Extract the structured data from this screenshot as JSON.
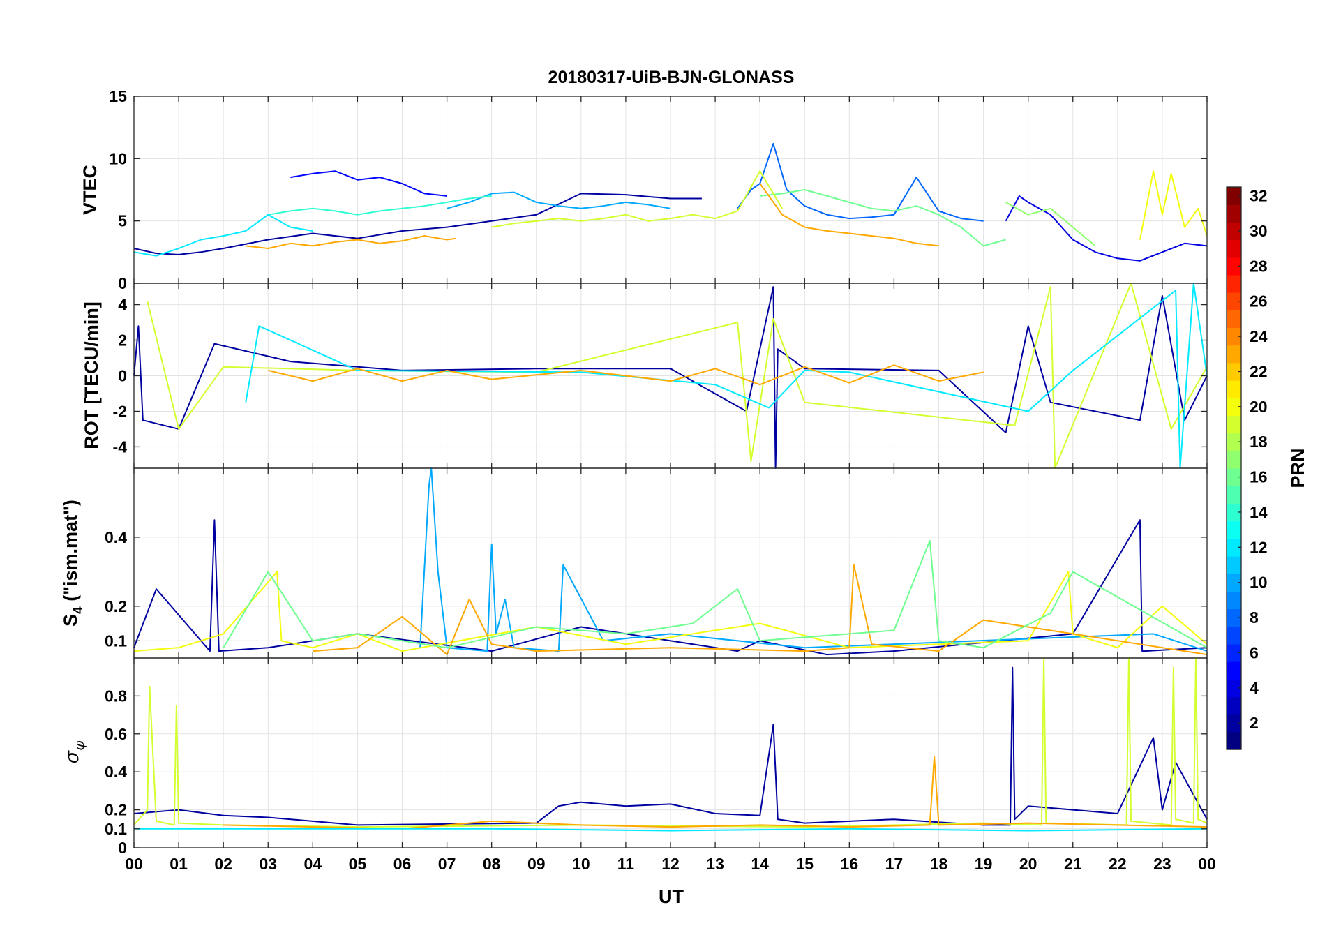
{
  "chart_data": [
    {
      "type": "line",
      "title": "20180317-UiB-BJN-GLONASS",
      "ylabel": "VTEC",
      "ylim": [
        0,
        15
      ],
      "yticks": [
        0,
        5,
        10,
        15
      ],
      "grid": true,
      "series": [
        {
          "prn": 2,
          "x": [
            0,
            0.5,
            1,
            1.5,
            2,
            3,
            4,
            5,
            6,
            7,
            8,
            9,
            10,
            11,
            12,
            12.7
          ],
          "y": [
            2.8,
            2.4,
            2.3,
            2.5,
            2.8,
            3.5,
            4.0,
            3.6,
            4.2,
            4.5,
            5.0,
            5.5,
            7.2,
            7.1,
            6.8,
            6.8
          ]
        },
        {
          "prn": 5,
          "x": [
            3.5,
            4,
            4.5,
            5,
            5.5,
            6,
            6.5,
            7
          ],
          "y": [
            8.5,
            8.8,
            9.0,
            8.3,
            8.5,
            8.0,
            7.2,
            7.0
          ]
        },
        {
          "prn": 8,
          "x": [
            13.5,
            13.8,
            14,
            14.3,
            14.6,
            15,
            15.5,
            16,
            16.5,
            17,
            17.5,
            18,
            18.5,
            19
          ],
          "y": [
            6.0,
            7.5,
            8.0,
            11.2,
            7.5,
            6.2,
            5.5,
            5.2,
            5.3,
            5.5,
            8.5,
            5.8,
            5.2,
            5.0
          ]
        },
        {
          "prn": 4,
          "x": [
            19.5,
            19.8,
            20,
            20.5,
            21,
            21.5,
            22,
            22.5,
            23,
            23.5,
            24
          ],
          "y": [
            5.0,
            7.0,
            6.5,
            5.5,
            3.5,
            2.5,
            2.0,
            1.8,
            2.5,
            3.2,
            3.0
          ]
        },
        {
          "prn": 10,
          "x": [
            7,
            7.5,
            8,
            8.5,
            9,
            9.5,
            10,
            10.5,
            11,
            11.5,
            12
          ],
          "y": [
            6.0,
            6.5,
            7.2,
            7.3,
            6.5,
            6.2,
            6.0,
            6.2,
            6.5,
            6.3,
            6.0
          ]
        },
        {
          "prn": 14,
          "x": [
            3,
            3.5,
            4,
            4.5,
            5,
            5.5,
            6,
            6.5,
            7,
            7.5,
            8
          ],
          "y": [
            5.5,
            5.8,
            6.0,
            5.8,
            5.5,
            5.8,
            6.0,
            6.2,
            6.5,
            6.8,
            7.0
          ]
        },
        {
          "prn": 12,
          "x": [
            0,
            0.5,
            1,
            1.5,
            2,
            2.5,
            3,
            3.5,
            4
          ],
          "y": [
            2.5,
            2.2,
            2.8,
            3.5,
            3.8,
            4.2,
            5.5,
            4.5,
            4.2
          ]
        },
        {
          "prn": 16,
          "x": [
            14,
            14.5,
            15,
            15.5,
            16,
            16.5,
            17,
            17.5,
            18,
            18.5,
            19,
            19.5
          ],
          "y": [
            7.0,
            7.2,
            7.5,
            7.0,
            6.5,
            6.0,
            5.8,
            6.2,
            5.5,
            4.5,
            3.0,
            3.5
          ]
        },
        {
          "prn": 19,
          "x": [
            8,
            8.5,
            9,
            9.5,
            10,
            10.5,
            11,
            11.5,
            12,
            12.5,
            13,
            13.5,
            14,
            14.5
          ],
          "y": [
            4.5,
            4.8,
            5.0,
            5.2,
            5.0,
            5.2,
            5.5,
            5.0,
            5.2,
            5.5,
            5.2,
            5.8,
            9.0,
            6.0
          ]
        },
        {
          "prn": 20,
          "x": [
            22.5,
            22.8,
            23,
            23.2,
            23.5,
            23.8,
            24
          ],
          "y": [
            3.5,
            9.0,
            5.5,
            8.8,
            4.5,
            6.0,
            3.8
          ]
        },
        {
          "prn": 23,
          "x": [
            2.5,
            3,
            3.5,
            4,
            4.5,
            5,
            5.5,
            6,
            6.5,
            7,
            7.2
          ],
          "y": [
            3.0,
            2.8,
            3.2,
            3.0,
            3.3,
            3.5,
            3.2,
            3.4,
            3.8,
            3.5,
            3.6
          ]
        },
        {
          "prn": 23,
          "x": [
            14,
            14.5,
            15,
            15.5,
            16,
            16.5,
            17,
            17.5,
            18
          ],
          "y": [
            8.0,
            5.5,
            4.5,
            4.2,
            4.0,
            3.8,
            3.6,
            3.2,
            3.0
          ]
        },
        {
          "prn": 17,
          "x": [
            19.5,
            20,
            20.5,
            21,
            21.5
          ],
          "y": [
            6.5,
            5.5,
            6.0,
            4.5,
            3.0
          ]
        }
      ]
    },
    {
      "type": "line",
      "ylabel": "ROT [TECU/min]",
      "ylim": [
        -5.2,
        5.2
      ],
      "yticks": [
        -4,
        -2,
        0,
        2,
        4
      ],
      "grid": true,
      "series": [
        {
          "prn": 2,
          "x": [
            0,
            0.1,
            0.2,
            1,
            1.8,
            3.5,
            6,
            9,
            12,
            13.7,
            14.3,
            14.35,
            14.4,
            15,
            18,
            19.5,
            20,
            20.5,
            22.5,
            23,
            23.5,
            24
          ],
          "y": [
            0,
            2.8,
            -2.5,
            -3.0,
            1.8,
            0.8,
            0.3,
            0.4,
            0.4,
            -2.0,
            5.0,
            -5.2,
            1.5,
            0.4,
            0.3,
            -3.2,
            2.8,
            -1.5,
            -2.5,
            4.5,
            -2.5,
            0
          ]
        },
        {
          "prn": 19,
          "x": [
            0.3,
            1,
            2,
            5,
            9,
            13.5,
            13.8,
            14.3,
            15,
            19.7,
            20.5,
            20.6,
            22.3,
            23.2,
            24
          ],
          "y": [
            4.2,
            -3.0,
            0.5,
            0.3,
            0.2,
            3.0,
            -4.8,
            3.2,
            -1.5,
            -2.8,
            5.0,
            -5.2,
            5.2,
            -3.0,
            0.5
          ]
        },
        {
          "prn": 12,
          "x": [
            2.5,
            2.8,
            5,
            10,
            13,
            14.2,
            15,
            16,
            20,
            21,
            23.3,
            23.4,
            23.7,
            24
          ],
          "y": [
            -1.5,
            2.8,
            0.3,
            0.2,
            -0.5,
            -1.8,
            0.3,
            0.2,
            -2.0,
            0.3,
            4.8,
            -5.2,
            5.2,
            0
          ]
        },
        {
          "prn": 23,
          "x": [
            3,
            4,
            5,
            6,
            7,
            8,
            10,
            12,
            13,
            14,
            15,
            16,
            17,
            18,
            19
          ],
          "y": [
            0.3,
            -0.3,
            0.4,
            -0.3,
            0.3,
            -0.2,
            0.3,
            -0.3,
            0.4,
            -0.5,
            0.5,
            -0.4,
            0.6,
            -0.3,
            0.2
          ]
        }
      ]
    },
    {
      "type": "line",
      "ylabel": "S4 (\"ism.mat\")",
      "ylim": [
        0.05,
        0.6
      ],
      "yticks": [
        0.1,
        0.2,
        0.4
      ],
      "grid": true,
      "series": [
        {
          "prn": 2,
          "x": [
            0,
            0.5,
            1.7,
            1.8,
            1.9,
            3,
            5,
            8,
            10,
            12.5,
            13.5,
            14,
            15.5,
            17,
            21,
            22.5,
            22.55,
            22.6,
            24
          ],
          "y": [
            0.08,
            0.25,
            0.07,
            0.45,
            0.07,
            0.08,
            0.12,
            0.07,
            0.14,
            0.09,
            0.07,
            0.1,
            0.06,
            0.07,
            0.12,
            0.45,
            0.07,
            0.07,
            0.08
          ]
        },
        {
          "prn": 10,
          "x": [
            6.4,
            6.6,
            6.65,
            6.8,
            7,
            7.9,
            8.0,
            8.1,
            8.3,
            8.5,
            9.5,
            9.6,
            10.5,
            12,
            15,
            22.8,
            24
          ],
          "y": [
            0.08,
            0.55,
            0.6,
            0.3,
            0.08,
            0.07,
            0.38,
            0.12,
            0.22,
            0.08,
            0.07,
            0.32,
            0.1,
            0.12,
            0.08,
            0.12,
            0.07
          ]
        },
        {
          "prn": 20,
          "x": [
            0,
            1,
            2,
            3.2,
            3.3,
            4,
            5,
            6,
            9,
            11,
            14,
            16,
            20,
            20.9,
            21,
            22,
            23,
            24
          ],
          "y": [
            0.07,
            0.08,
            0.12,
            0.3,
            0.1,
            0.08,
            0.12,
            0.07,
            0.14,
            0.09,
            0.15,
            0.08,
            0.1,
            0.3,
            0.12,
            0.08,
            0.2,
            0.09
          ]
        },
        {
          "prn": 23,
          "x": [
            4,
            5,
            6,
            7,
            7.5,
            8,
            9,
            12,
            15,
            16,
            16.1,
            16.5,
            18,
            19,
            24
          ],
          "y": [
            0.07,
            0.08,
            0.17,
            0.06,
            0.22,
            0.09,
            0.07,
            0.08,
            0.07,
            0.08,
            0.32,
            0.09,
            0.07,
            0.16,
            0.06
          ]
        },
        {
          "prn": 16,
          "x": [
            2,
            3,
            4,
            5,
            7,
            9,
            11,
            12.5,
            13.5,
            14,
            17,
            17.8,
            18,
            19,
            20.5,
            21,
            24
          ],
          "y": [
            0.08,
            0.3,
            0.1,
            0.12,
            0.08,
            0.14,
            0.12,
            0.15,
            0.25,
            0.1,
            0.13,
            0.39,
            0.1,
            0.08,
            0.18,
            0.3,
            0.08
          ]
        }
      ]
    },
    {
      "type": "line",
      "ylabel": "σφ",
      "ylim": [
        0,
        1.0
      ],
      "yticks": [
        0,
        0.1,
        0.2,
        0.4,
        0.6,
        0.8
      ],
      "grid": true,
      "series": [
        {
          "prn": 2,
          "x": [
            0,
            1,
            2,
            3,
            4,
            5,
            9,
            9.5,
            10,
            11,
            12,
            13,
            14,
            14.3,
            14.4,
            15,
            16,
            17,
            19,
            19.6,
            19.65,
            19.7,
            20,
            21,
            22,
            22.8,
            23,
            23.3,
            24
          ],
          "y": [
            0.18,
            0.2,
            0.17,
            0.16,
            0.14,
            0.12,
            0.13,
            0.22,
            0.24,
            0.22,
            0.23,
            0.18,
            0.17,
            0.65,
            0.15,
            0.13,
            0.14,
            0.15,
            0.12,
            0.12,
            0.95,
            0.15,
            0.22,
            0.2,
            0.18,
            0.58,
            0.2,
            0.45,
            0.15
          ]
        },
        {
          "prn": 19,
          "x": [
            0,
            0.3,
            0.35,
            0.5,
            0.9,
            0.95,
            1.0,
            2,
            5,
            10,
            15,
            19,
            20.3,
            20.35,
            20.4,
            22.2,
            22.25,
            22.3,
            23.2,
            23.25,
            23.3,
            23.7,
            23.75,
            23.8,
            24
          ],
          "y": [
            0.12,
            0.2,
            0.85,
            0.14,
            0.12,
            0.75,
            0.13,
            0.12,
            0.11,
            0.12,
            0.11,
            0.13,
            0.12,
            1.0,
            0.13,
            0.12,
            1.0,
            0.14,
            0.12,
            0.95,
            0.15,
            0.13,
            1.0,
            0.15,
            0.13
          ]
        },
        {
          "prn": 23,
          "x": [
            2,
            4,
            6,
            8,
            10,
            12,
            14,
            16,
            17.8,
            17.9,
            18,
            20,
            22,
            24
          ],
          "y": [
            0.12,
            0.11,
            0.1,
            0.14,
            0.12,
            0.11,
            0.12,
            0.11,
            0.12,
            0.48,
            0.12,
            0.13,
            0.12,
            0.11
          ]
        },
        {
          "prn": 12,
          "x": [
            0,
            4,
            8,
            12,
            16,
            20,
            24
          ],
          "y": [
            0.1,
            0.1,
            0.1,
            0.09,
            0.1,
            0.09,
            0.1
          ]
        }
      ]
    }
  ],
  "xaxis": {
    "label": "UT",
    "ticks": [
      "00",
      "01",
      "02",
      "03",
      "04",
      "05",
      "06",
      "07",
      "08",
      "09",
      "10",
      "11",
      "12",
      "13",
      "14",
      "15",
      "16",
      "17",
      "18",
      "19",
      "20",
      "21",
      "22",
      "23",
      "00"
    ]
  },
  "colorbar": {
    "label": "PRN",
    "colormap": "jet",
    "range": [
      1,
      32
    ],
    "ticks": [
      2,
      4,
      6,
      8,
      10,
      12,
      14,
      16,
      18,
      20,
      22,
      24,
      26,
      28,
      30,
      32
    ]
  }
}
